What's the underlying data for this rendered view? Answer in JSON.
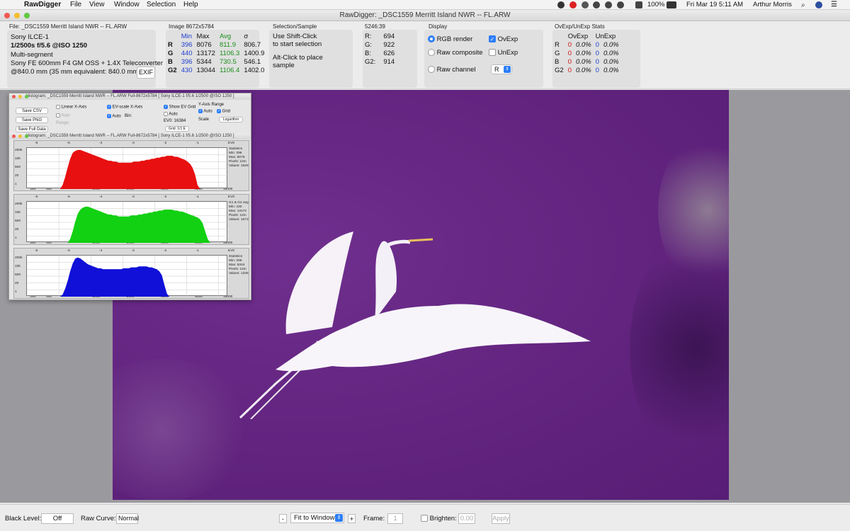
{
  "menubar": {
    "app_name": "RawDigger",
    "menus": [
      "File",
      "View",
      "Window",
      "Selection",
      "Help"
    ],
    "battery": "100%",
    "datetime": "Fri Mar 19  5:11 AM",
    "user": "Arthur Morris"
  },
  "window": {
    "title": "RawDigger: _DSC1559 Merritt Island NWR  -- FL.ARW"
  },
  "file_info": {
    "label": "File: _DSC1559 Merritt Island NWR  -- FL.ARW",
    "camera": "Sony ILCE-1",
    "exposure": "1/2500s f/5.6 @ISO 1250",
    "metering": "Multi-segment",
    "lens": "Sony FE 600mm F4 GM OSS + 1.4X Teleconverter",
    "focal": "@840.0 mm (35 mm equivalent: 840.0 mm)",
    "exif_button": "EXIF"
  },
  "image_stats": {
    "label": "Image 8672x5784",
    "headers": [
      "Min",
      "Max",
      "Avg",
      "σ"
    ],
    "rows": [
      {
        "ch": "R",
        "min": "396",
        "max": "8076",
        "avg": "811.9",
        "sigma": "806.7"
      },
      {
        "ch": "G",
        "min": "440",
        "max": "13172",
        "avg": "1106.3",
        "sigma": "1400.9"
      },
      {
        "ch": "B",
        "min": "396",
        "max": "5344",
        "avg": "730.5",
        "sigma": "546.1"
      },
      {
        "ch": "G2",
        "min": "430",
        "max": "13044",
        "avg": "1106.4",
        "sigma": "1402.0"
      }
    ]
  },
  "selection": {
    "label": "Selection/Sample",
    "line1": "Use Shift-Click",
    "line2": "to start selection",
    "line3": "Alt-Click to place",
    "line4": "sample"
  },
  "sample": {
    "label": "5246:39",
    "rows": [
      {
        "ch": "R:",
        "val": "694"
      },
      {
        "ch": "G:",
        "val": "922"
      },
      {
        "ch": "B:",
        "val": "626"
      },
      {
        "ch": "G2:",
        "val": "914"
      }
    ]
  },
  "display": {
    "label": "Display",
    "rgb_render": "RGB render",
    "raw_composite": "Raw composite",
    "raw_channel": "Raw channel",
    "ovexp": "OvExp",
    "unexp": "UnExp",
    "channel_select": "R"
  },
  "ovexp_stats": {
    "label": "OvExp/UnExp Stats",
    "headers": [
      "OvExp",
      "UnExp"
    ],
    "rows": [
      {
        "ch": "R",
        "ov": "0",
        "ovp": "0.0%",
        "un": "0",
        "unp": "0.0%"
      },
      {
        "ch": "G",
        "ov": "0",
        "ovp": "0.0%",
        "un": "0",
        "unp": "0.0%"
      },
      {
        "ch": "B",
        "ov": "0",
        "ovp": "0.0%",
        "un": "0",
        "unp": "0.0%"
      },
      {
        "ch": "G2",
        "ov": "0",
        "ovp": "0.0%",
        "un": "0",
        "unp": "0.0%"
      }
    ]
  },
  "histogram": {
    "title": "Histogram: _DSC1559 Merritt Island NWR  -- FL.ARW Full-8672x5784 [ Sony ILCE-1 f/5.6 1/2500 @ISO 1250 ]",
    "title2": "Histogram: _DSC1559 Merritt Island NWR  -- FL.ARW Full-8672x5784 [ Sony ILCE-1 f/5.6 1/2500 @ISO 1250 ]",
    "save_csv": "Save CSV",
    "save_png": "Save PNG",
    "save_full": "Save Full Data",
    "linear_x": "Linear X-Axis",
    "ev_scale": "EV-scale X-Axis",
    "show_ev_grid": "Show EV Grid",
    "y_axis_range": "Y-Axis Range",
    "auto": "Auto",
    "bin": "Bin:",
    "grid": "Grid",
    "scale": "Scale",
    "scale_value": "Logarithm",
    "ev0": "EV0: 16384",
    "grid_sel": "Grid: 1/1 E",
    "range": "Range:",
    "ev_ticks": [
      "-6",
      "-5",
      "-4",
      "-3",
      "-2",
      "-1",
      "EV0"
    ],
    "x_ticks": [
      "280",
      "400",
      "1000",
      "2000",
      "4000",
      "8000",
      "16000"
    ],
    "y_ticks": [
      "200k",
      "10k",
      "500",
      "20",
      "1"
    ],
    "panels": [
      {
        "color": "#e81010",
        "stats": [
          "Statistics",
          "Min: 396",
          "Max: 8076",
          "Pixels: 12m",
          "Values: 1528"
        ],
        "profile": [
          0,
          0,
          0,
          0,
          0,
          0,
          0,
          0,
          0,
          0,
          0,
          0,
          0,
          0,
          4,
          12,
          22,
          31,
          37,
          39,
          40,
          40,
          39,
          38,
          37,
          36,
          35,
          34,
          33,
          32,
          31,
          30,
          29,
          29,
          28,
          28,
          27,
          27,
          27,
          27,
          27,
          27,
          28,
          28,
          28,
          29,
          29,
          30,
          30,
          31,
          31,
          32,
          32,
          33,
          33,
          34,
          34,
          34,
          33,
          33,
          32,
          31,
          30,
          28,
          26,
          22,
          15,
          4,
          0,
          0,
          0,
          0,
          0,
          0,
          0,
          0,
          0,
          0,
          0,
          0
        ]
      },
      {
        "color": "#12d012",
        "stats": [
          "G1 & G2 avg",
          "Min: 430",
          "Max: 13172",
          "Pixels: 12m",
          "Values: 1673"
        ],
        "profile": [
          0,
          0,
          0,
          0,
          0,
          0,
          0,
          0,
          0,
          0,
          0,
          0,
          0,
          0,
          0,
          0,
          0,
          4,
          12,
          22,
          30,
          34,
          36,
          37,
          37,
          36,
          35,
          34,
          33,
          32,
          31,
          30,
          29,
          29,
          28,
          28,
          27,
          27,
          27,
          27,
          27,
          28,
          28,
          28,
          29,
          29,
          30,
          30,
          31,
          31,
          32,
          32,
          33,
          33,
          34,
          34,
          34,
          34,
          33,
          33,
          32,
          32,
          31,
          30,
          29,
          28,
          27,
          26,
          24,
          20,
          12,
          4,
          0,
          0,
          0,
          0,
          0,
          0,
          0,
          0
        ]
      },
      {
        "color": "#1010d8",
        "stats": [
          "Statistics",
          "Min: 396",
          "Max: 5344",
          "Pixels: 12m",
          "Values: 1336"
        ],
        "profile": [
          0,
          0,
          0,
          0,
          0,
          0,
          0,
          0,
          0,
          0,
          0,
          0,
          0,
          0,
          2,
          8,
          16,
          26,
          34,
          39,
          40,
          39,
          37,
          35,
          33,
          32,
          31,
          30,
          29,
          29,
          28,
          28,
          28,
          28,
          28,
          28,
          28,
          28,
          29,
          29,
          29,
          30,
          30,
          30,
          31,
          31,
          31,
          31,
          30,
          30,
          29,
          28,
          26,
          22,
          12,
          3,
          0,
          0,
          0,
          0,
          0,
          0,
          0,
          0,
          0,
          0,
          0,
          0,
          0,
          0,
          0,
          0,
          0,
          0,
          0,
          0,
          0,
          0,
          0,
          0
        ]
      }
    ]
  },
  "bottombar": {
    "black_level_label": "Black Level:",
    "black_level_value": "Off",
    "raw_curve_label": "Raw Curve:",
    "raw_curve_value": "Normal",
    "minus": "-",
    "plus": "+",
    "zoom": "Fit to Window",
    "frame_label": "Frame:",
    "frame_value": "1",
    "brighten_label": "Brighten:",
    "brighten_value": "0.00",
    "apply": "Apply"
  },
  "colors": {
    "accent": "#2d7ef7",
    "photo_bg": "#62247f",
    "viewer_bg": "#9a9a9e"
  }
}
